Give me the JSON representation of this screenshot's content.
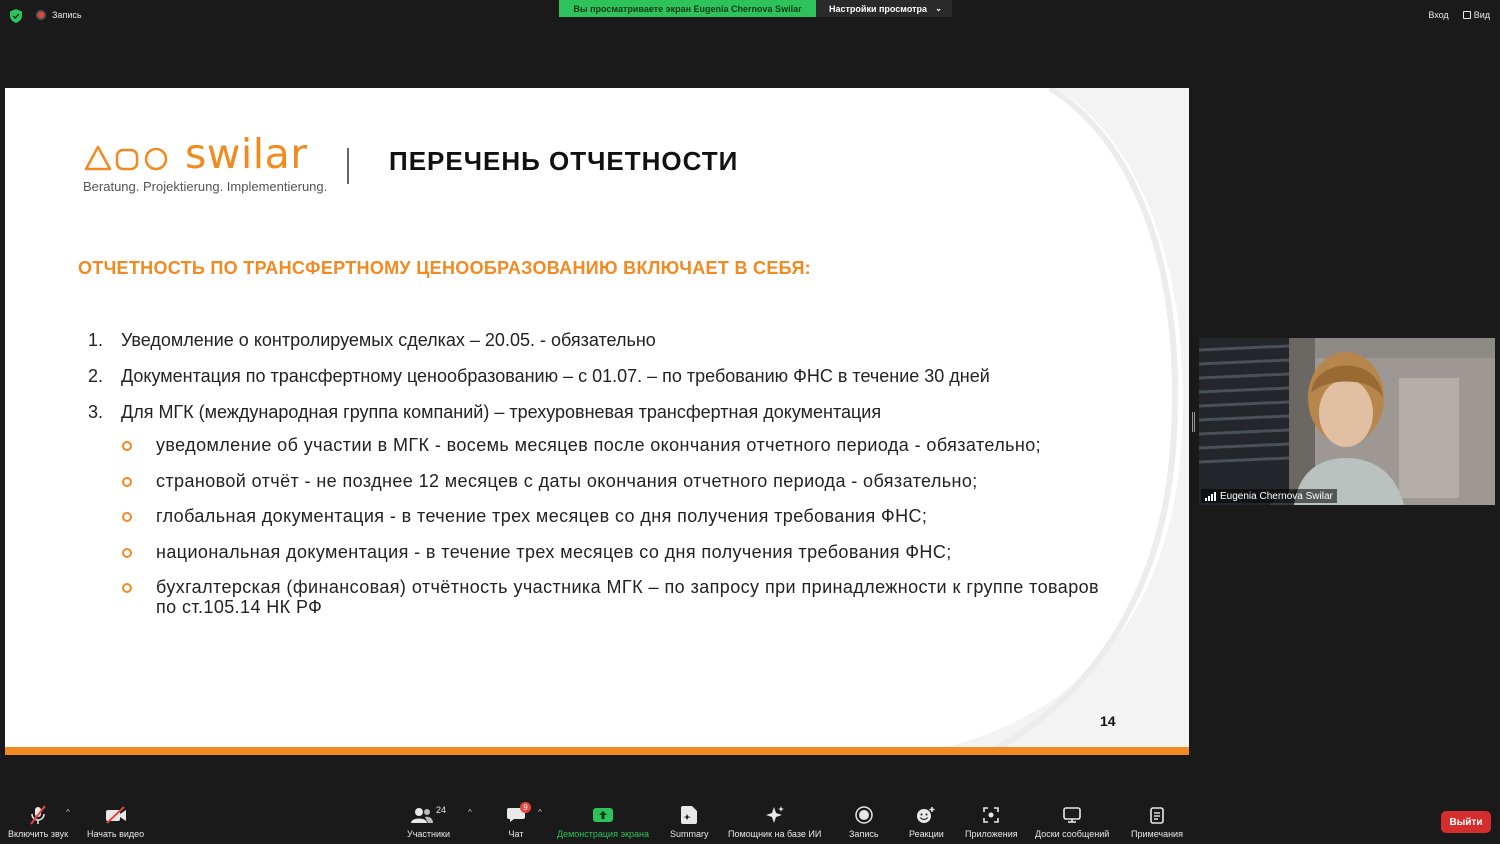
{
  "topbar": {
    "recording_label": "Запись",
    "share_banner": "Вы просматриваете экран Eugenia Chernova Swilar",
    "view_settings": "Настройки просмотра",
    "signin_label": "Вход",
    "view_label": "Вид"
  },
  "slide": {
    "logo_word": "swilar",
    "logo_tagline": "Beratung. Projektierung. Implementierung.",
    "title": "ПЕРЕЧЕНЬ ОТЧЕТНОСТИ",
    "section_heading": "ОТЧЕТНОСТЬ ПО ТРАНСФЕРТНОМУ ЦЕНООБРАЗОВАНИЮ ВКЛЮЧАЕТ В СЕБЯ:",
    "numbered_items": [
      {
        "num": "1.",
        "text": "Уведомление о контролируемых сделках – 20.05. - обязательно"
      },
      {
        "num": "2.",
        "text": "Документация по трансфертному ценообразованию – с 01.07. – по требованию ФНС в течение 30 дней"
      },
      {
        "num": "3.",
        "text": "Для МГК (международная группа компаний) – трехуровневая трансфертная документация"
      }
    ],
    "sub_items": [
      "уведомление об участии в МГК - восемь месяцев после окончания отчетного периода - обязательно;",
      "страновой отчёт - не позднее 12 месяцев с даты окончания отчетного периода - обязательно;",
      "глобальная документация - в течение трех месяцев со дня получения требования ФНС;",
      "национальная документация - в течение трех месяцев со дня получения требования ФНС;",
      "бухгалтерская (финансовая) отчётность  участника МГК – по запросу при принадлежности к группе товаров по ст.105.14 НК РФ"
    ],
    "page_number": "14",
    "accent_color": "#f28a22"
  },
  "participant": {
    "name": "Eugenia Chernova Swilar"
  },
  "toolbar": {
    "unmute_label": "Включить звук",
    "start_video_label": "Начать видео",
    "participants_count": "24",
    "participants_label": "Участники",
    "chat_badge": "9",
    "chat_label": "Чат",
    "share_label": "Демонстрация экрана",
    "summary_label": "Summary",
    "ai_label": "Помощник на базе ИИ",
    "record_label": "Запись",
    "reactions_label": "Реакции",
    "apps_label": "Приложения",
    "boards_label": "Доски сообщений",
    "notes_label": "Примечания",
    "leave_label": "Выйти",
    "share_color": "#2ec35a",
    "leave_color": "#d32d2d"
  }
}
